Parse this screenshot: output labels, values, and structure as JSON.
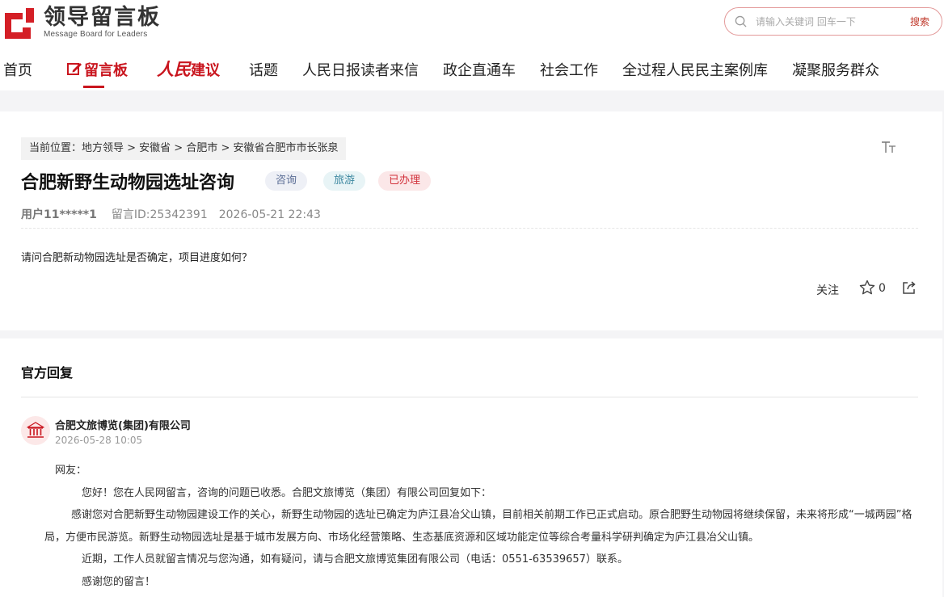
{
  "header": {
    "logo_title": "领导留言板",
    "logo_subtitle": "Message Board for Leaders",
    "search": {
      "placeholder": "请输入关键词 回车一下",
      "button": "搜索"
    }
  },
  "nav": {
    "items": [
      "首页",
      "留言板",
      "人民建议",
      "话题",
      "人民日报读者来信",
      "政企直通车",
      "社会工作",
      "全过程人民民主案例库",
      "凝聚服务群众"
    ],
    "brand_part1": "人民",
    "brand_part2": "建议"
  },
  "message": {
    "breadcrumb": "当前位置：地方领导 > 安徽省 > 合肥市 > 安徽省合肥市市长张泉",
    "font_toggle": "TT",
    "title": "合肥新野生动物园选址咨询",
    "tags": [
      "咨询",
      "旅游",
      "已办理"
    ],
    "user": "用户11*****1",
    "message_id": "留言ID:25342391",
    "time": "2026-05-21 22:43",
    "content": "请问合肥新动物园选址是否确定，项目进度如何？",
    "follow_label": "关注",
    "star_count": "0"
  },
  "reply": {
    "heading": "官方回复",
    "org": "合肥文旅博览(集团)有限公司",
    "time": "2026-05-28 10:05",
    "greeting": "网友：",
    "p1": "您好！您在人民网留言，咨询的问题已收悉。合肥文旅博览（集团）有限公司回复如下：",
    "p2": "感谢您对合肥新野生动物园建设工作的关心，新野生动物园的选址已确定为庐江县冶父山镇，目前相关前期工作已正式启动。原合肥野生动物园将继续保留，未来将形成“一城两园”格局，方便市民游览。新野生动物园选址是基于城市发展方向、市场化经营策略、生态基底资源和区域功能定位等综合考量科学研判确定为庐江县冶父山镇。",
    "p3": "近期，工作人员就留言情况与您沟通，如有疑问，请与合肥文旅博览集团有限公司（电话：0551-63539657）联系。",
    "p4": "感谢您的留言！"
  },
  "colors": {
    "accent": "#c9151e",
    "page_bg": "#f4f4f6"
  }
}
